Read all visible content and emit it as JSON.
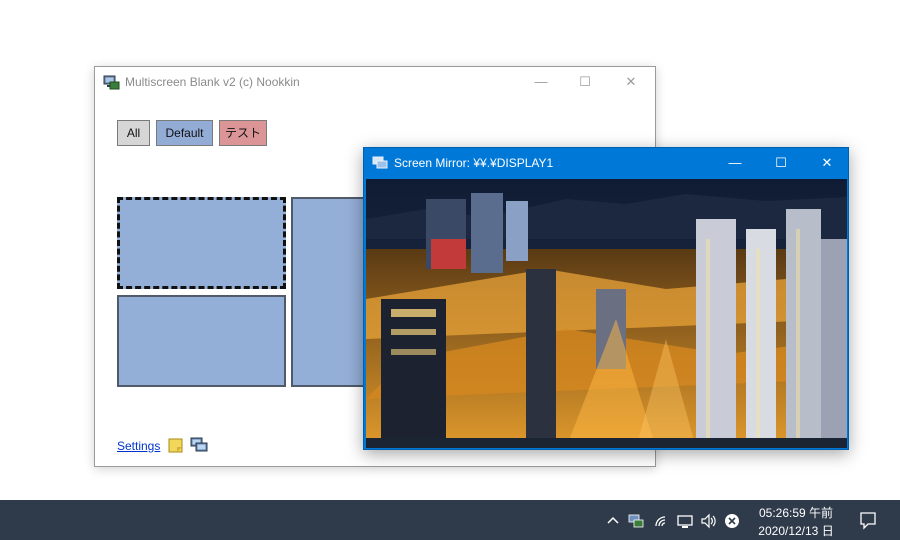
{
  "multiscreen_window": {
    "title": "Multiscreen Blank v2 (c) Nookkin",
    "controls": {
      "minimize": "—",
      "maximize": "☐",
      "close": "✕"
    },
    "profile_buttons": [
      {
        "label": "All",
        "color": "#d6d6d6"
      },
      {
        "label": "Default",
        "color": "#93acd6"
      },
      {
        "label": "テスト",
        "color": "#dc9597"
      }
    ],
    "settings_link": "Settings"
  },
  "mirror_window": {
    "title": "Screen Mirror: ¥¥.¥DISPLAY1",
    "controls": {
      "minimize": "—",
      "maximize": "☐",
      "close": "✕"
    }
  },
  "taskbar": {
    "clock_time": "05:26:59 午前",
    "clock_date": "2020/12/13 日",
    "tray_icons": [
      "chevron-up-icon",
      "screen-app-icon",
      "wifi-icon",
      "network-icon",
      "volume-icon",
      "close-circle-icon",
      "notification-icon"
    ]
  },
  "colors": {
    "accent": "#0078d7",
    "taskbar": "#2f3b4b",
    "screen_fill": "#93aed7"
  }
}
